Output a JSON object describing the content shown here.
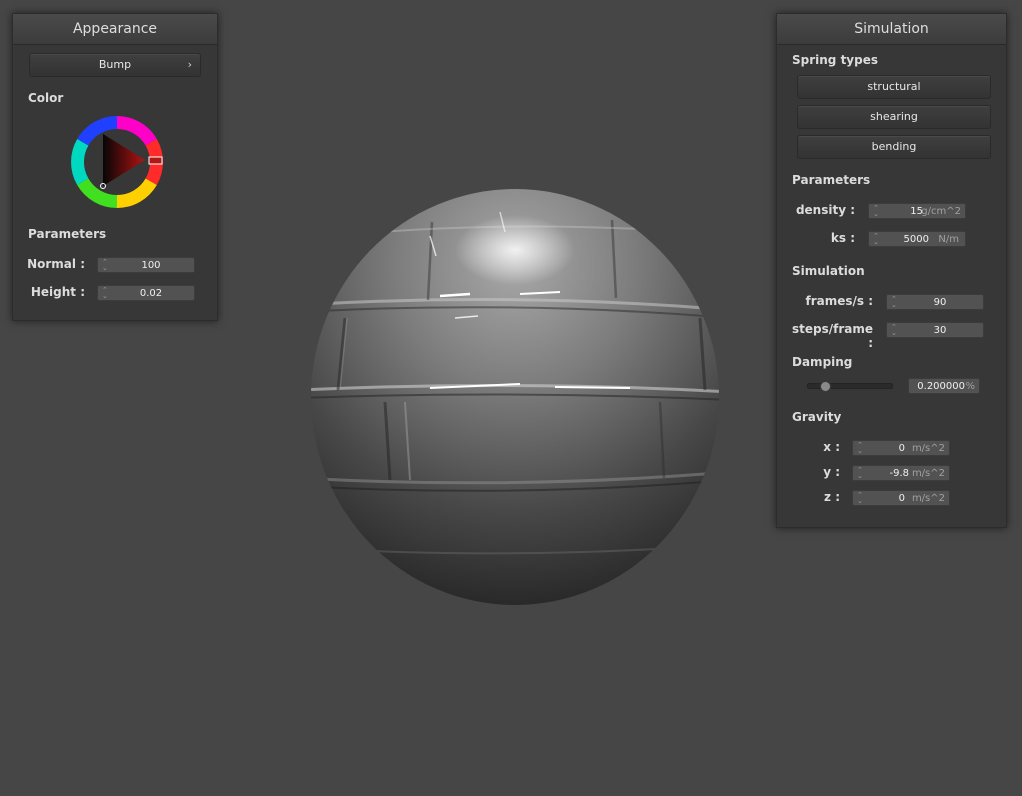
{
  "appearance": {
    "title": "Appearance",
    "shader_button": "Bump",
    "shader_chevron": "›",
    "color_label": "Color",
    "parameters_label": "Parameters",
    "normal_label": "Normal :",
    "normal_value": "100",
    "height_label": "Height :",
    "height_value": "0.02"
  },
  "simulation": {
    "title": "Simulation",
    "spring_types_label": "Spring types",
    "spring_buttons": [
      "structural",
      "shearing",
      "bending"
    ],
    "parameters_label": "Parameters",
    "density_label": "density :",
    "density_value": "15",
    "density_unit": "g/cm^2",
    "ks_label": "ks :",
    "ks_value": "5000",
    "ks_unit": "N/m",
    "simulation_label": "Simulation",
    "fps_label": "frames/s :",
    "fps_value": "90",
    "steps_label": "steps/frame :",
    "steps_value": "30",
    "damping_label": "Damping",
    "damping_value": "0.200000",
    "damping_unit": "%",
    "damping_fraction": 0.2,
    "gravity_label": "Gravity",
    "gx_label": "x :",
    "gx_value": "0",
    "gy_label": "y :",
    "gy_value": "-9.8",
    "gz_label": "z :",
    "gz_value": "0",
    "gravity_unit": "m/s^2"
  },
  "colors": {
    "background": "#464646",
    "panel": "#373737",
    "picker_selected": "#b01818"
  },
  "icons": {
    "spinner": "up-down-arrows",
    "chevron": "chevron-right"
  }
}
